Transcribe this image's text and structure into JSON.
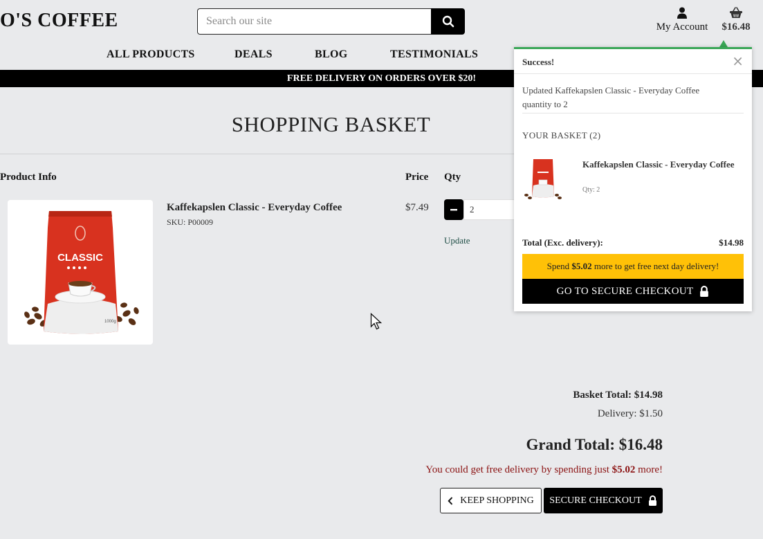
{
  "header": {
    "brand": "O'S COFFEE",
    "search_placeholder": "Search our site",
    "account_label": "My Account",
    "basket_total": "$16.48"
  },
  "nav": {
    "items": [
      "ALL PRODUCTS",
      "DEALS",
      "BLOG",
      "TESTIMONIALS"
    ]
  },
  "banner": "FREE DELIVERY ON ORDERS OVER $20!",
  "page_title": "SHOPPING BASKET",
  "table": {
    "headers": [
      "Product Info",
      "Price",
      "Qty"
    ],
    "rows": [
      {
        "name": "Kaffekapslen Classic - Everyday Coffee",
        "sku": "SKU: P00009",
        "price": "$7.49",
        "qty": "2",
        "update_label": "Update",
        "bag_brand": "CLASSIC",
        "bag_weight": "1000g"
      }
    ]
  },
  "summary": {
    "basket_total": "Basket Total: $14.98",
    "delivery": "Delivery: $1.50",
    "grand_total": "Grand Total: $16.48",
    "free_msg_prefix": "You could get free delivery by spending just",
    "free_msg_amount": "$5.02",
    "free_msg_suffix": "more!"
  },
  "buttons": {
    "keep_shopping": "KEEP SHOPPING",
    "secure_checkout": "SECURE CHECKOUT"
  },
  "popup": {
    "title": "Success!",
    "close": "×",
    "message": "Updated Kaffekapslen Classic - Everyday Coffee quantity to 2",
    "basket_label": "YOUR BASKET (2)",
    "item_name": "Kaffekapslen Classic - Everyday Coffee",
    "item_qty": "Qty: 2",
    "total_label": "Total (Exc. delivery):",
    "total_value": "$14.98",
    "promo_prefix": "Spend",
    "promo_amount": "$5.02",
    "promo_suffix": "more to get free next day delivery!",
    "checkout_label": "GO TO SECURE CHECKOUT"
  },
  "colors": {
    "accent_success": "#3aa757",
    "promo": "#ffc107",
    "warning_text": "#8b1212",
    "bag_red": "#d8321f"
  }
}
